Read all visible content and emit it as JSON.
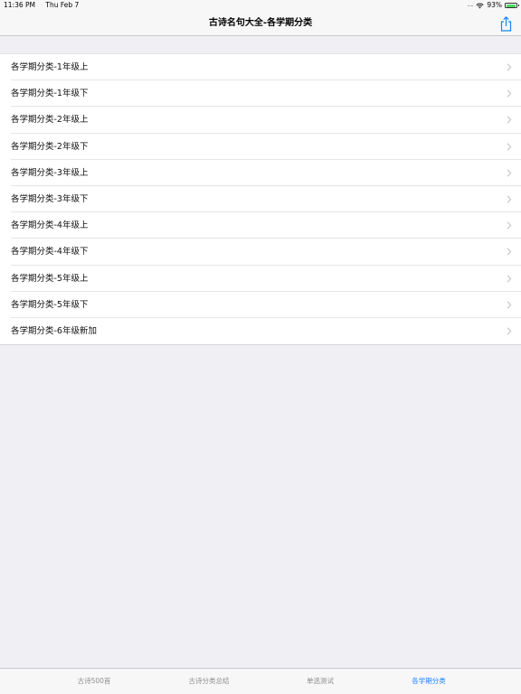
{
  "status_bar": {
    "time": "11:36 PM",
    "date": "Thu Feb 7",
    "signal": ".....",
    "battery": "93%",
    "battery_level": 0.93
  },
  "nav": {
    "title": "古诗名句大全-各学期分类",
    "share_icon": "share-icon"
  },
  "list": {
    "items": [
      {
        "label": "各学期分类-1年级上"
      },
      {
        "label": "各学期分类-1年级下"
      },
      {
        "label": "各学期分类-2年级上"
      },
      {
        "label": "各学期分类-2年级下"
      },
      {
        "label": "各学期分类-3年级上"
      },
      {
        "label": "各学期分类-3年级下"
      },
      {
        "label": "各学期分类-4年级上"
      },
      {
        "label": "各学期分类-4年级下"
      },
      {
        "label": "各学期分类-5年级上"
      },
      {
        "label": "各学期分类-5年级下"
      },
      {
        "label": "各学期分类-6年级新加"
      }
    ]
  },
  "tabs": [
    {
      "label": "古诗500首",
      "active": false
    },
    {
      "label": "古诗分类总结",
      "active": false
    },
    {
      "label": "单选测试",
      "active": false
    },
    {
      "label": "各学期分类",
      "active": true
    }
  ],
  "colors": {
    "accent": "#1a82fb",
    "background": "#efeff4",
    "inactive_tab": "#8e8e93"
  }
}
